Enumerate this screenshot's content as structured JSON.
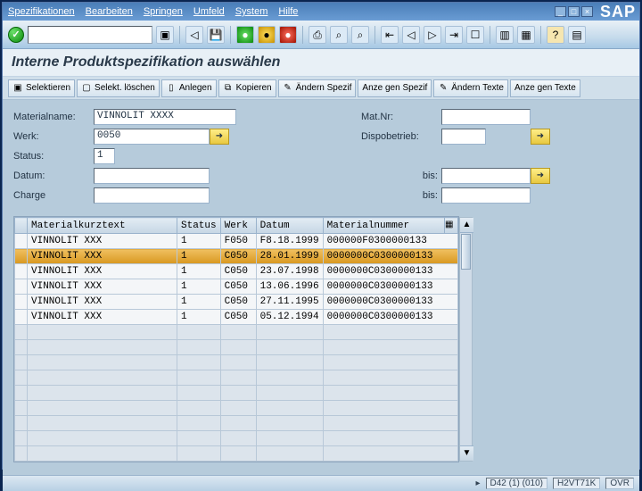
{
  "menu": {
    "items": [
      "Spezifikationen",
      "Bearbeiten",
      "Springen",
      "Umfeld",
      "System",
      "Hilfe"
    ]
  },
  "logo": "SAP",
  "screentitle": "Interne Produktspezifikation auswählen",
  "apptoolbar": {
    "b0": "Selektieren",
    "b1": "Selekt. löschen",
    "b2": "Anlegen",
    "b3": "Kopieren",
    "b4": "Ändern Spezif",
    "b5": "Anze gen Spezif",
    "b6": "Ändern Texte",
    "b7": "Anze gen Texte"
  },
  "form": {
    "materialname_lbl": "Materialname:",
    "materialname_val": "VINNOLIT  XXXX",
    "matnr_lbl": "Mat.Nr:",
    "werk_lbl": "Werk:",
    "werk_val": "0050",
    "dispobetrieb_lbl": "Dispobetrieb:",
    "status_lbl": "Status:",
    "status_val": "1",
    "datum_lbl": "Datum:",
    "bis1_lbl": "bis:",
    "charge_lbl": "Charge",
    "bis2_lbl": "bis:"
  },
  "table": {
    "cols": {
      "c0": "Materialkurztext",
      "c1": "Status",
      "c2": "Werk",
      "c3": "Datum",
      "c4": "Materialnummer"
    },
    "rows": [
      {
        "c0": "VINNOLIT  XXX",
        "c1": "1",
        "c2": "F050",
        "c3": "F8.18.1999",
        "c4": "000000F0300000133"
      },
      {
        "c0": "VINNOLIT  XXX",
        "c1": "1",
        "c2": "C050",
        "c3": "28.01.1999",
        "c4": "0000000C0300000133"
      },
      {
        "c0": "VINNOLIT  XXX",
        "c1": "1",
        "c2": "C050",
        "c3": "23.07.1998",
        "c4": "0000000C0300000133"
      },
      {
        "c0": "VINNOLIT  XXX",
        "c1": "1",
        "c2": "C050",
        "c3": "13.06.1996",
        "c4": "0000000C0300000133"
      },
      {
        "c0": "VINNOLIT  XXX",
        "c1": "1",
        "c2": "C050",
        "c3": "27.11.1995",
        "c4": "0000000C0300000133"
      },
      {
        "c0": "VINNOLIT  XXX",
        "c1": "1",
        "c2": "C050",
        "c3": "05.12.1994",
        "c4": "0000000C0300000133"
      }
    ]
  },
  "status": {
    "sys": "D42 (1) (010)",
    "host": "H2VT71K",
    "mode": "OVR"
  },
  "icons": {
    "check": "✓",
    "back": "◀",
    "save": "💾",
    "globe_g": "●",
    "globe_y": "●",
    "globe_r": "●",
    "print": "⎙",
    "find": "🔍",
    "findn": "🔎",
    "new": "☐",
    "copy": "⧉",
    "paste": "📋",
    "cut": "✂",
    "help": "?",
    "cfg": "▤",
    "arrow": "➜",
    "tri": "▸",
    "xx": "✕",
    "pg": "▥",
    "doc": "▯",
    "pencil": "✎"
  }
}
